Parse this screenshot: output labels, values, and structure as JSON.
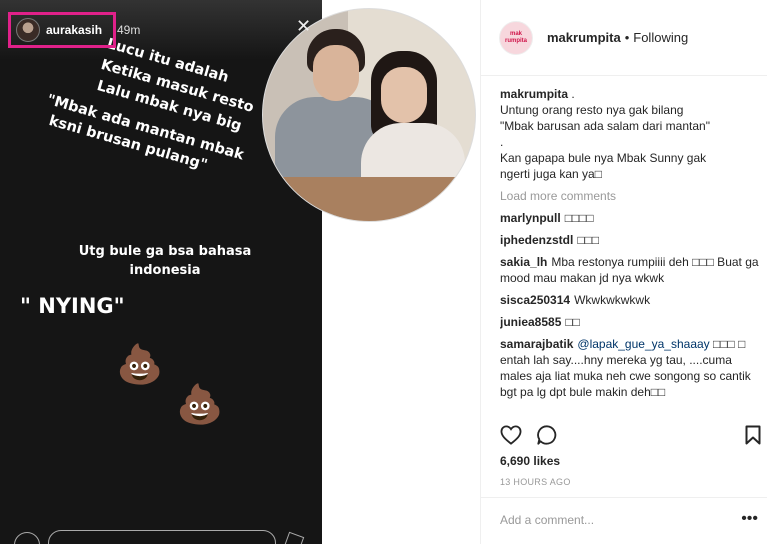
{
  "story": {
    "username": "aurakasih",
    "time": "49m",
    "lines": [
      "Lucu itu adalah",
      "Ketika masuk resto",
      "Lalu mbak nya big",
      "\"Mbak ada mantan mbak",
      "ksni brusan pulang\""
    ],
    "line6": "",
    "middle_line1": "Utg bule ga bsa bahasa",
    "middle_line2": "indonesia",
    "shout": "\" NYING\"",
    "emoji": "💩"
  },
  "post": {
    "username": "makrumpita",
    "separator": "•",
    "following_label": "Following",
    "avatar_text": "mak rumpita",
    "caption": {
      "username": "makrumpita",
      "lines": [
        "Untung orang resto nya gak bilang",
        "\"Mbak barusan ada salam dari mantan\"",
        ".",
        "Kan gapapa bule nya Mbak Sunny gak",
        "ngerti juga kan ya□"
      ],
      "first_line_after_name": "."
    },
    "load_more": "Load more comments",
    "comments": [
      {
        "user": "marlynpull",
        "text": "□□□□"
      },
      {
        "user": "iphedenzstdl",
        "text": "□□□"
      },
      {
        "user": "sakia_lh",
        "text": "Mba restonya rumpiiii deh □□□ Buat ga mood mau makan jd nya wkwk"
      },
      {
        "user": "sisca250314",
        "text": "Wkwkwkwkwk"
      },
      {
        "user": "juniea8585",
        "text": "□□"
      },
      {
        "user": "samarajbatik",
        "mention": "@lapak_gue_ya_shaaay",
        "text": "□□□ □ entah lah say....hny mereka yg tau, ....cuma males aja liat muka neh cwe songong so cantik bgt pa lg dpt bule makin deh□□"
      }
    ],
    "likes": "6,690 likes",
    "timestamp": "13 HOURS AGO",
    "add_comment_placeholder": "Add a comment...",
    "more_label": "•••"
  },
  "icons": {
    "like": "heart-icon",
    "comment": "speech-bubble-icon",
    "save": "bookmark-icon",
    "close": "close-icon",
    "options": "more-options-icon"
  },
  "colors": {
    "story_highlight_border": "#e0218a",
    "mention": "#003569",
    "muted": "#999999"
  }
}
